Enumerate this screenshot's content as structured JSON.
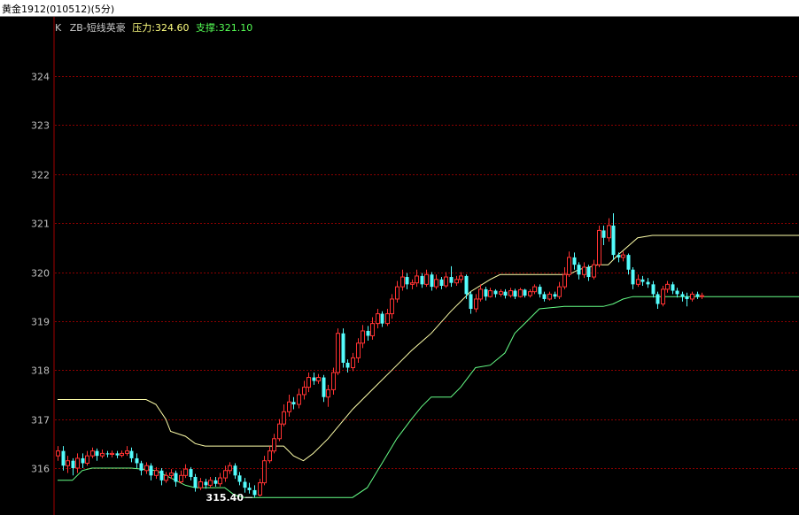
{
  "title": "黄金1912(010512)(5分)",
  "legend": {
    "k_label": "K",
    "indicator": "ZB-短线英豪",
    "pressure_label": "压力:",
    "pressure_value": "324.60",
    "support_label": "支撑:",
    "support_value": "321.10"
  },
  "colors": {
    "background": "#000000",
    "up_candle": "#ff3232",
    "down_candle": "#54fcfc",
    "pressure_line": "#ffffaa",
    "support_line": "#66ff88",
    "grid": "#8b0000",
    "axis_text": "#c0c0c0",
    "border": "#a00000"
  },
  "chart_data": {
    "type": "candlestick",
    "grid": true,
    "ylim": [
      315.2,
      325.2
    ],
    "y_ticks": [
      "324",
      "323",
      "322",
      "321",
      "320",
      "319",
      "318",
      "317",
      "316"
    ],
    "min_label": "315.40",
    "candles": [
      [
        316.25,
        316.35,
        316.45,
        316.15
      ],
      [
        316.35,
        316.05,
        316.45,
        315.95
      ],
      [
        316.05,
        316.15,
        316.25,
        315.9
      ],
      [
        316.15,
        316.0,
        316.2,
        315.85
      ],
      [
        316.0,
        316.2,
        316.3,
        315.9
      ],
      [
        316.2,
        316.1,
        316.3,
        316.0
      ],
      [
        316.1,
        316.25,
        316.35,
        316.05
      ],
      [
        316.25,
        316.35,
        316.42,
        316.2
      ],
      [
        316.35,
        316.25,
        316.4,
        316.15
      ],
      [
        316.25,
        316.3,
        316.38,
        316.2
      ],
      [
        316.3,
        316.28,
        316.35,
        316.22
      ],
      [
        316.28,
        316.3,
        316.36,
        316.22
      ],
      [
        316.3,
        316.26,
        316.35,
        316.2
      ],
      [
        316.26,
        316.3,
        316.36,
        316.22
      ],
      [
        316.3,
        316.35,
        316.45,
        316.25
      ],
      [
        316.35,
        316.2,
        316.42,
        316.12
      ],
      [
        316.2,
        316.1,
        316.3,
        316.0
      ],
      [
        316.1,
        315.95,
        316.15,
        315.85
      ],
      [
        315.95,
        316.05,
        316.12,
        315.88
      ],
      [
        316.05,
        315.85,
        316.1,
        315.75
      ],
      [
        315.85,
        315.95,
        316.02,
        315.78
      ],
      [
        315.95,
        315.75,
        316.0,
        315.65
      ],
      [
        315.75,
        315.85,
        315.92,
        315.7
      ],
      [
        315.85,
        315.9,
        315.98,
        315.78
      ],
      [
        315.9,
        315.72,
        315.95,
        315.62
      ],
      [
        315.72,
        315.85,
        315.95,
        315.68
      ],
      [
        315.85,
        315.98,
        316.08,
        315.8
      ],
      [
        315.98,
        315.82,
        316.02,
        315.75
      ],
      [
        315.82,
        315.6,
        315.88,
        315.52
      ],
      [
        315.6,
        315.72,
        315.8,
        315.55
      ],
      [
        315.72,
        315.65,
        315.78,
        315.58
      ],
      [
        315.65,
        315.75,
        315.82,
        315.6
      ],
      [
        315.75,
        315.68,
        315.82,
        315.62
      ],
      [
        315.68,
        315.8,
        315.9,
        315.62
      ],
      [
        315.8,
        315.95,
        316.05,
        315.72
      ],
      [
        315.95,
        316.05,
        316.12,
        315.88
      ],
      [
        316.05,
        315.85,
        316.1,
        315.78
      ],
      [
        315.85,
        315.72,
        315.92,
        315.65
      ],
      [
        315.72,
        315.6,
        315.8,
        315.5
      ],
      [
        315.6,
        315.55,
        315.7,
        315.48
      ],
      [
        315.55,
        315.45,
        315.65,
        315.4
      ],
      [
        315.45,
        315.7,
        315.78,
        315.42
      ],
      [
        315.7,
        316.15,
        316.25,
        315.65
      ],
      [
        316.15,
        316.35,
        316.45,
        316.1
      ],
      [
        316.35,
        316.6,
        316.7,
        316.3
      ],
      [
        316.6,
        316.9,
        317.0,
        316.55
      ],
      [
        316.9,
        317.15,
        317.3,
        316.85
      ],
      [
        317.15,
        317.35,
        317.5,
        317.05
      ],
      [
        317.35,
        317.3,
        317.45,
        317.2
      ],
      [
        317.3,
        317.5,
        317.62,
        317.22
      ],
      [
        317.5,
        317.65,
        317.78,
        317.4
      ],
      [
        317.65,
        317.85,
        317.95,
        317.55
      ],
      [
        317.85,
        317.78,
        317.95,
        317.7
      ],
      [
        317.78,
        317.85,
        317.92,
        317.72
      ],
      [
        317.85,
        317.45,
        317.9,
        317.35
      ],
      [
        317.45,
        317.6,
        317.7,
        317.25
      ],
      [
        317.6,
        317.95,
        318.05,
        317.5
      ],
      [
        317.95,
        318.75,
        318.85,
        317.9
      ],
      [
        318.75,
        318.15,
        318.85,
        318.05
      ],
      [
        318.15,
        318.05,
        318.22,
        317.95
      ],
      [
        318.05,
        318.25,
        318.35,
        317.98
      ],
      [
        318.25,
        318.55,
        318.65,
        318.15
      ],
      [
        318.55,
        318.8,
        318.92,
        318.45
      ],
      [
        318.8,
        318.7,
        318.9,
        318.6
      ],
      [
        318.7,
        318.95,
        319.08,
        318.62
      ],
      [
        318.95,
        319.15,
        319.25,
        318.85
      ],
      [
        319.15,
        318.95,
        319.2,
        318.88
      ],
      [
        318.95,
        319.15,
        319.25,
        318.9
      ],
      [
        319.15,
        319.45,
        319.55,
        319.05
      ],
      [
        319.45,
        319.7,
        319.82,
        319.38
      ],
      [
        319.7,
        319.9,
        320.05,
        319.62
      ],
      [
        319.9,
        319.75,
        319.98,
        319.65
      ],
      [
        319.75,
        319.78,
        319.85,
        319.65
      ],
      [
        319.78,
        319.92,
        320.05,
        319.7
      ],
      [
        319.92,
        319.75,
        319.98,
        319.68
      ],
      [
        319.75,
        319.95,
        320.05,
        319.7
      ],
      [
        319.95,
        319.7,
        320.0,
        319.62
      ],
      [
        319.7,
        319.85,
        319.95,
        319.65
      ],
      [
        319.85,
        319.72,
        319.9,
        319.65
      ],
      [
        319.72,
        319.9,
        320.0,
        319.68
      ],
      [
        319.9,
        319.78,
        320.12,
        319.7
      ],
      [
        319.78,
        319.85,
        319.92,
        319.72
      ],
      [
        319.85,
        319.92,
        320.0,
        319.78
      ],
      [
        319.92,
        319.55,
        319.95,
        319.45
      ],
      [
        319.55,
        319.25,
        319.6,
        319.15
      ],
      [
        319.25,
        319.45,
        319.55,
        319.18
      ],
      [
        319.45,
        319.65,
        319.75,
        319.4
      ],
      [
        319.65,
        319.5,
        319.7,
        319.42
      ],
      [
        319.5,
        319.62,
        319.68,
        319.48
      ],
      [
        319.62,
        319.55,
        319.65,
        319.48
      ],
      [
        319.55,
        319.6,
        319.65,
        319.5
      ],
      [
        319.6,
        319.52,
        319.65,
        319.46
      ],
      [
        319.52,
        319.62,
        319.68,
        319.48
      ],
      [
        319.62,
        319.5,
        319.66,
        319.45
      ],
      [
        319.5,
        319.64,
        319.68,
        319.48
      ],
      [
        319.64,
        319.52,
        319.66,
        319.48
      ],
      [
        319.52,
        319.6,
        319.65,
        319.48
      ],
      [
        319.6,
        319.7,
        319.75,
        319.55
      ],
      [
        319.7,
        319.55,
        319.75,
        319.48
      ],
      [
        319.55,
        319.45,
        319.6,
        319.4
      ],
      [
        319.45,
        319.55,
        319.6,
        319.42
      ],
      [
        319.55,
        319.5,
        319.6,
        319.45
      ],
      [
        319.5,
        319.7,
        319.8,
        319.45
      ],
      [
        319.7,
        319.95,
        320.1,
        319.65
      ],
      [
        319.95,
        320.3,
        320.42,
        319.9
      ],
      [
        320.3,
        320.15,
        320.4,
        320.05
      ],
      [
        320.15,
        319.95,
        320.2,
        319.85
      ],
      [
        319.95,
        320.1,
        320.2,
        319.88
      ],
      [
        320.1,
        319.9,
        320.15,
        319.82
      ],
      [
        319.9,
        320.15,
        320.25,
        319.85
      ],
      [
        320.15,
        320.85,
        320.95,
        320.1
      ],
      [
        320.85,
        320.7,
        320.95,
        320.55
      ],
      [
        320.7,
        320.95,
        321.1,
        320.62
      ],
      [
        320.95,
        320.35,
        321.2,
        320.25
      ],
      [
        320.35,
        320.3,
        320.4,
        320.2
      ],
      [
        320.3,
        320.35,
        320.42,
        320.22
      ],
      [
        320.35,
        320.05,
        320.38,
        319.95
      ],
      [
        320.05,
        319.75,
        320.1,
        319.65
      ],
      [
        319.75,
        319.85,
        319.95,
        319.7
      ],
      [
        319.85,
        319.8,
        319.92,
        319.72
      ],
      [
        319.8,
        319.75,
        319.88,
        319.68
      ],
      [
        319.75,
        319.55,
        319.82,
        319.48
      ],
      [
        319.55,
        319.35,
        319.6,
        319.25
      ],
      [
        319.35,
        319.65,
        319.72,
        319.3
      ],
      [
        319.65,
        319.75,
        319.82,
        319.58
      ],
      [
        319.75,
        319.62,
        319.8,
        319.55
      ],
      [
        319.62,
        319.55,
        319.68,
        319.48
      ],
      [
        319.55,
        319.5,
        319.6,
        319.4
      ],
      [
        319.5,
        319.45,
        319.58,
        319.3
      ],
      [
        319.45,
        319.55,
        319.6,
        319.4
      ],
      [
        319.55,
        319.5,
        319.6,
        319.45
      ],
      [
        319.5,
        319.52,
        319.58,
        319.45
      ]
    ],
    "pressure": [
      [
        0,
        317.4
      ],
      [
        18,
        317.4
      ],
      [
        20,
        317.3
      ],
      [
        22,
        317.0
      ],
      [
        23,
        316.75
      ],
      [
        26,
        316.65
      ],
      [
        28,
        316.5
      ],
      [
        30,
        316.45
      ],
      [
        46,
        316.45
      ],
      [
        48,
        316.25
      ],
      [
        50,
        316.15
      ],
      [
        52,
        316.3
      ],
      [
        55,
        316.6
      ],
      [
        60,
        317.2
      ],
      [
        64,
        317.6
      ],
      [
        68,
        318.0
      ],
      [
        72,
        318.4
      ],
      [
        76,
        318.75
      ],
      [
        80,
        319.2
      ],
      [
        84,
        319.6
      ],
      [
        88,
        319.85
      ],
      [
        90,
        319.95
      ],
      [
        94,
        319.95
      ],
      [
        104,
        319.95
      ],
      [
        106,
        320.05
      ],
      [
        110,
        320.15
      ],
      [
        112,
        320.15
      ],
      [
        114,
        320.35
      ],
      [
        118,
        320.7
      ],
      [
        121,
        320.75
      ],
      [
        151,
        320.75
      ]
    ],
    "support": [
      [
        0,
        315.75
      ],
      [
        3,
        315.75
      ],
      [
        5,
        315.95
      ],
      [
        7,
        316.0
      ],
      [
        15,
        316.0
      ],
      [
        20,
        315.95
      ],
      [
        22,
        315.85
      ],
      [
        24,
        315.75
      ],
      [
        26,
        315.65
      ],
      [
        28,
        315.6
      ],
      [
        30,
        315.6
      ],
      [
        34,
        315.6
      ],
      [
        36,
        315.45
      ],
      [
        38,
        315.4
      ],
      [
        52,
        315.4
      ],
      [
        60,
        315.4
      ],
      [
        63,
        315.6
      ],
      [
        66,
        316.1
      ],
      [
        69,
        316.6
      ],
      [
        72,
        317.0
      ],
      [
        74,
        317.25
      ],
      [
        76,
        317.45
      ],
      [
        80,
        317.45
      ],
      [
        82,
        317.65
      ],
      [
        85,
        318.05
      ],
      [
        88,
        318.1
      ],
      [
        91,
        318.35
      ],
      [
        93,
        318.75
      ],
      [
        95,
        318.95
      ],
      [
        98,
        319.25
      ],
      [
        103,
        319.3
      ],
      [
        111,
        319.3
      ],
      [
        113,
        319.35
      ],
      [
        115,
        319.45
      ],
      [
        117,
        319.5
      ],
      [
        151,
        319.5
      ]
    ]
  }
}
